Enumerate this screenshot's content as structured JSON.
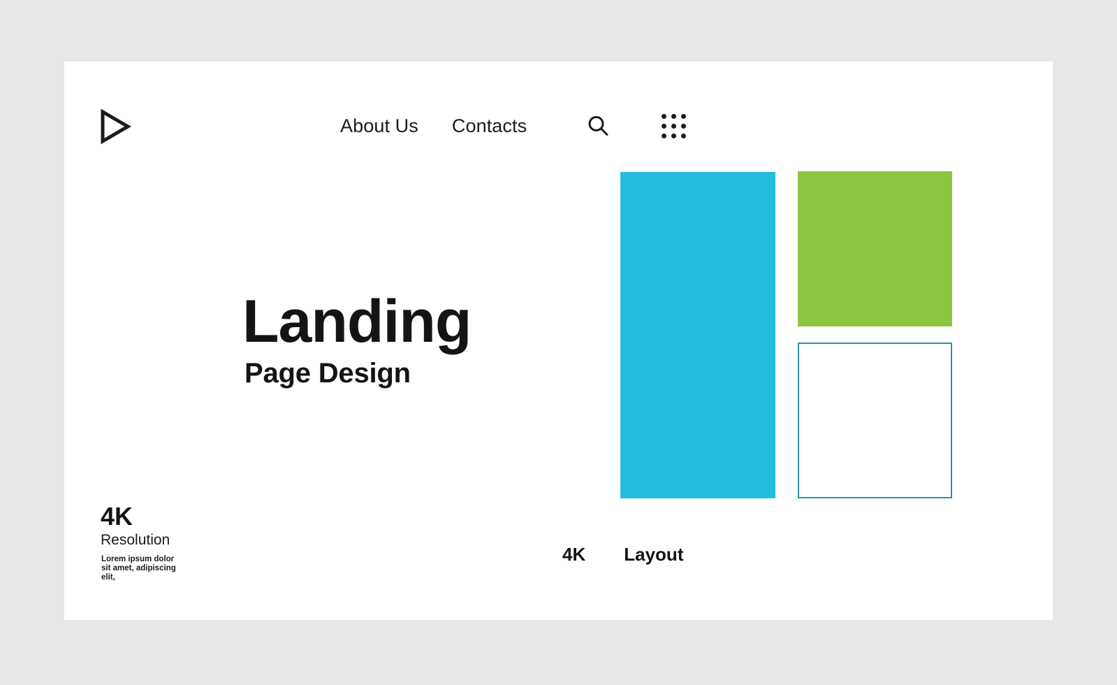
{
  "page": {
    "background_color": "#e6e7e9",
    "card_background": "#ffffff"
  },
  "header": {
    "logo": {
      "icon": "play-triangle-outline-icon",
      "label": "Play"
    },
    "nav_items": [
      {
        "label": "About Us"
      },
      {
        "label": "Contacts"
      }
    ],
    "actions": [
      {
        "icon": "search-icon",
        "label": "Search"
      },
      {
        "icon": "grid-menu-icon",
        "label": "Apps"
      }
    ]
  },
  "hero": {
    "title": "Landing",
    "subtitle": "Page Design"
  },
  "resolution_block": {
    "value": "4K",
    "label": "Resolution",
    "description": "Lorem ipsum dolor sit amet, adipiscing elit,"
  },
  "shapes": [
    {
      "name": "blue-panel",
      "color": "#26bce0",
      "fill": "solid"
    },
    {
      "name": "green-panel",
      "color": "#8cc63e",
      "fill": "solid"
    },
    {
      "name": "outline-panel",
      "color": "#2a8fa5",
      "fill": "outline"
    }
  ],
  "caption": {
    "value": "4K",
    "label": "Layout"
  },
  "colors": {
    "blue": "#26bce0",
    "green": "#8cc63e",
    "outline_border": "#2a8fa5",
    "text": "#141414",
    "page_bg": "#e6e7e9"
  }
}
